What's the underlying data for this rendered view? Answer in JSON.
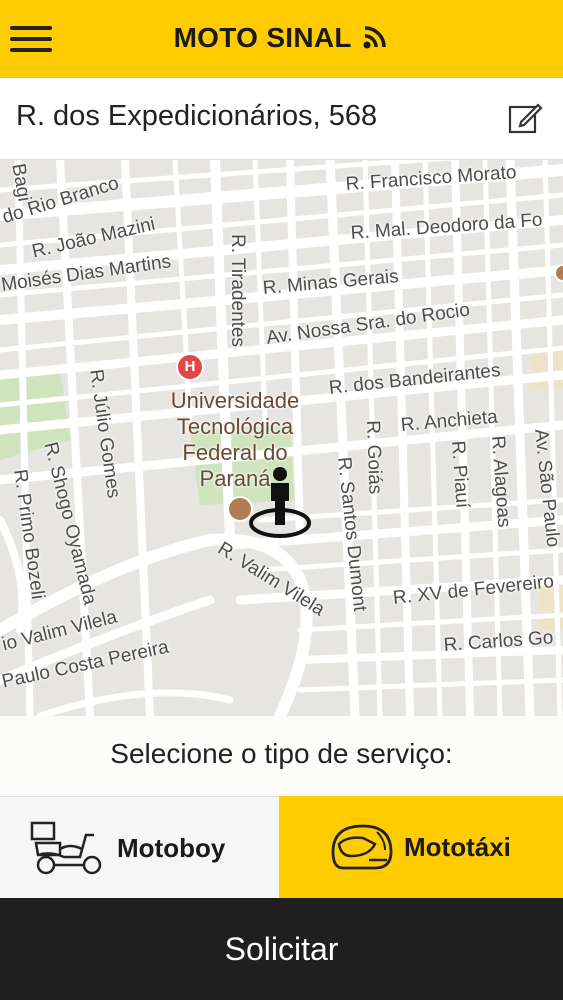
{
  "header": {
    "title": "MOTO SINAL"
  },
  "address": {
    "value": "R. dos Expedicionários, 568"
  },
  "map": {
    "streets": [
      "R. Francisco Morato",
      "do Rio Branco",
      "R. João Mazini",
      "R. Mal. Deodoro da Fo",
      "Moisés Dias Martins",
      "R. Tiradentes",
      "R. Minas Gerais",
      "Av. Nossa Sra. do Rocio",
      "R. dos Bandeirantes",
      "R. Júlio Gomes",
      "R. Anchieta",
      "R. Goiás",
      "R. Piauí",
      "R. Alagoas",
      "Av. São Paulo",
      "R. Shogo Oyamada",
      "R. Primo Bozeli",
      "R. Santos Dumont",
      "R. Valim Vilela",
      "R. XV de Fevereiro",
      "R. Carlos Go",
      "io Valim Vilela",
      "Paulo Costa Pereira",
      "Bagi"
    ],
    "poi": {
      "line1": "Universidade",
      "line2": "Tecnológica",
      "line3": "Federal do",
      "line4": "Paraná"
    },
    "hospital_letter": "H"
  },
  "service": {
    "prompt": "Selecione o tipo de serviço:",
    "options": [
      {
        "label": "Motoboy",
        "icon": "delivery-scooter-icon"
      },
      {
        "label": "Mototáxi",
        "icon": "helmet-icon"
      }
    ],
    "selected": "Mototáxi"
  },
  "submit_label": "Solicitar",
  "colors": {
    "accent": "#ffcc00",
    "dark": "#1f1f1f"
  }
}
